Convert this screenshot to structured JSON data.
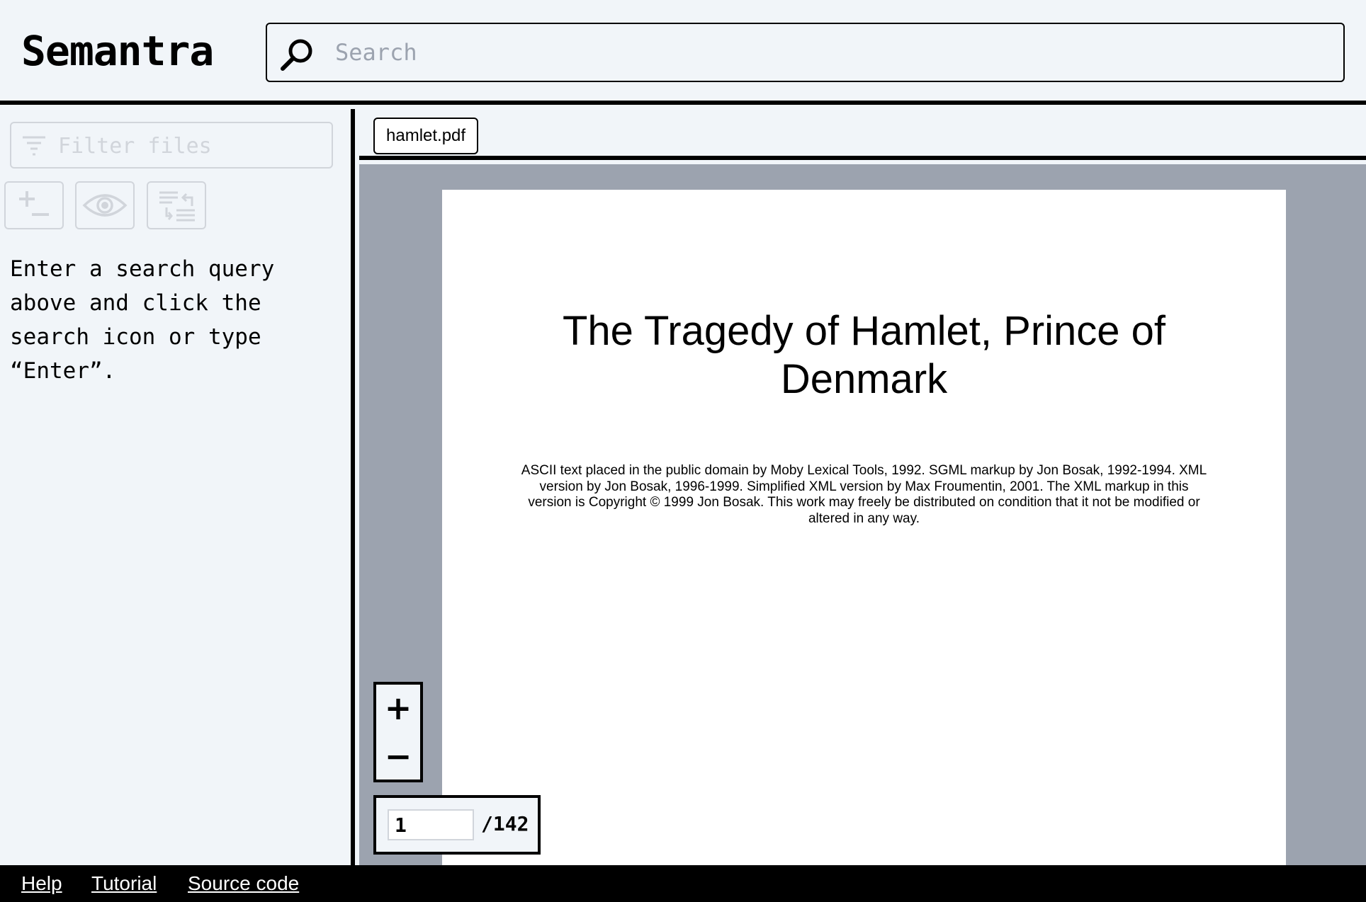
{
  "app": {
    "title": "Semantra"
  },
  "search": {
    "placeholder": "Search",
    "value": ""
  },
  "sidebar": {
    "filter_placeholder": "Filter files",
    "tools": [
      {
        "icon": "plus-minus-icon"
      },
      {
        "icon": "eye-icon"
      },
      {
        "icon": "reorder-list-icon"
      }
    ],
    "hint": "Enter a search query above and click the search icon or type “Enter”."
  },
  "tabs": [
    {
      "label": "hamlet.pdf"
    }
  ],
  "document": {
    "title": "The Tragedy of Hamlet, Prince of Denmark",
    "body": "ASCII text placed in the public domain by Moby Lexical Tools, 1992. SGML markup by Jon Bosak, 1992-1994. XML version by Jon Bosak, 1996-1999. Simplified XML version by Max Froumentin, 2001. The XML markup in this version is Copyright © 1999 Jon Bosak. This work may freely be distributed on condition that it not be modified or altered in any way."
  },
  "viewer": {
    "zoom_in": "+",
    "zoom_out": "−",
    "current_page": "1",
    "total_pages": "/142"
  },
  "footer": {
    "links": [
      "Help",
      "Tutorial",
      "Source code"
    ]
  },
  "colors": {
    "background": "#f1f5f9",
    "viewer_bg": "#9ca3af",
    "border": "#000000",
    "muted": "#d1d5db"
  }
}
